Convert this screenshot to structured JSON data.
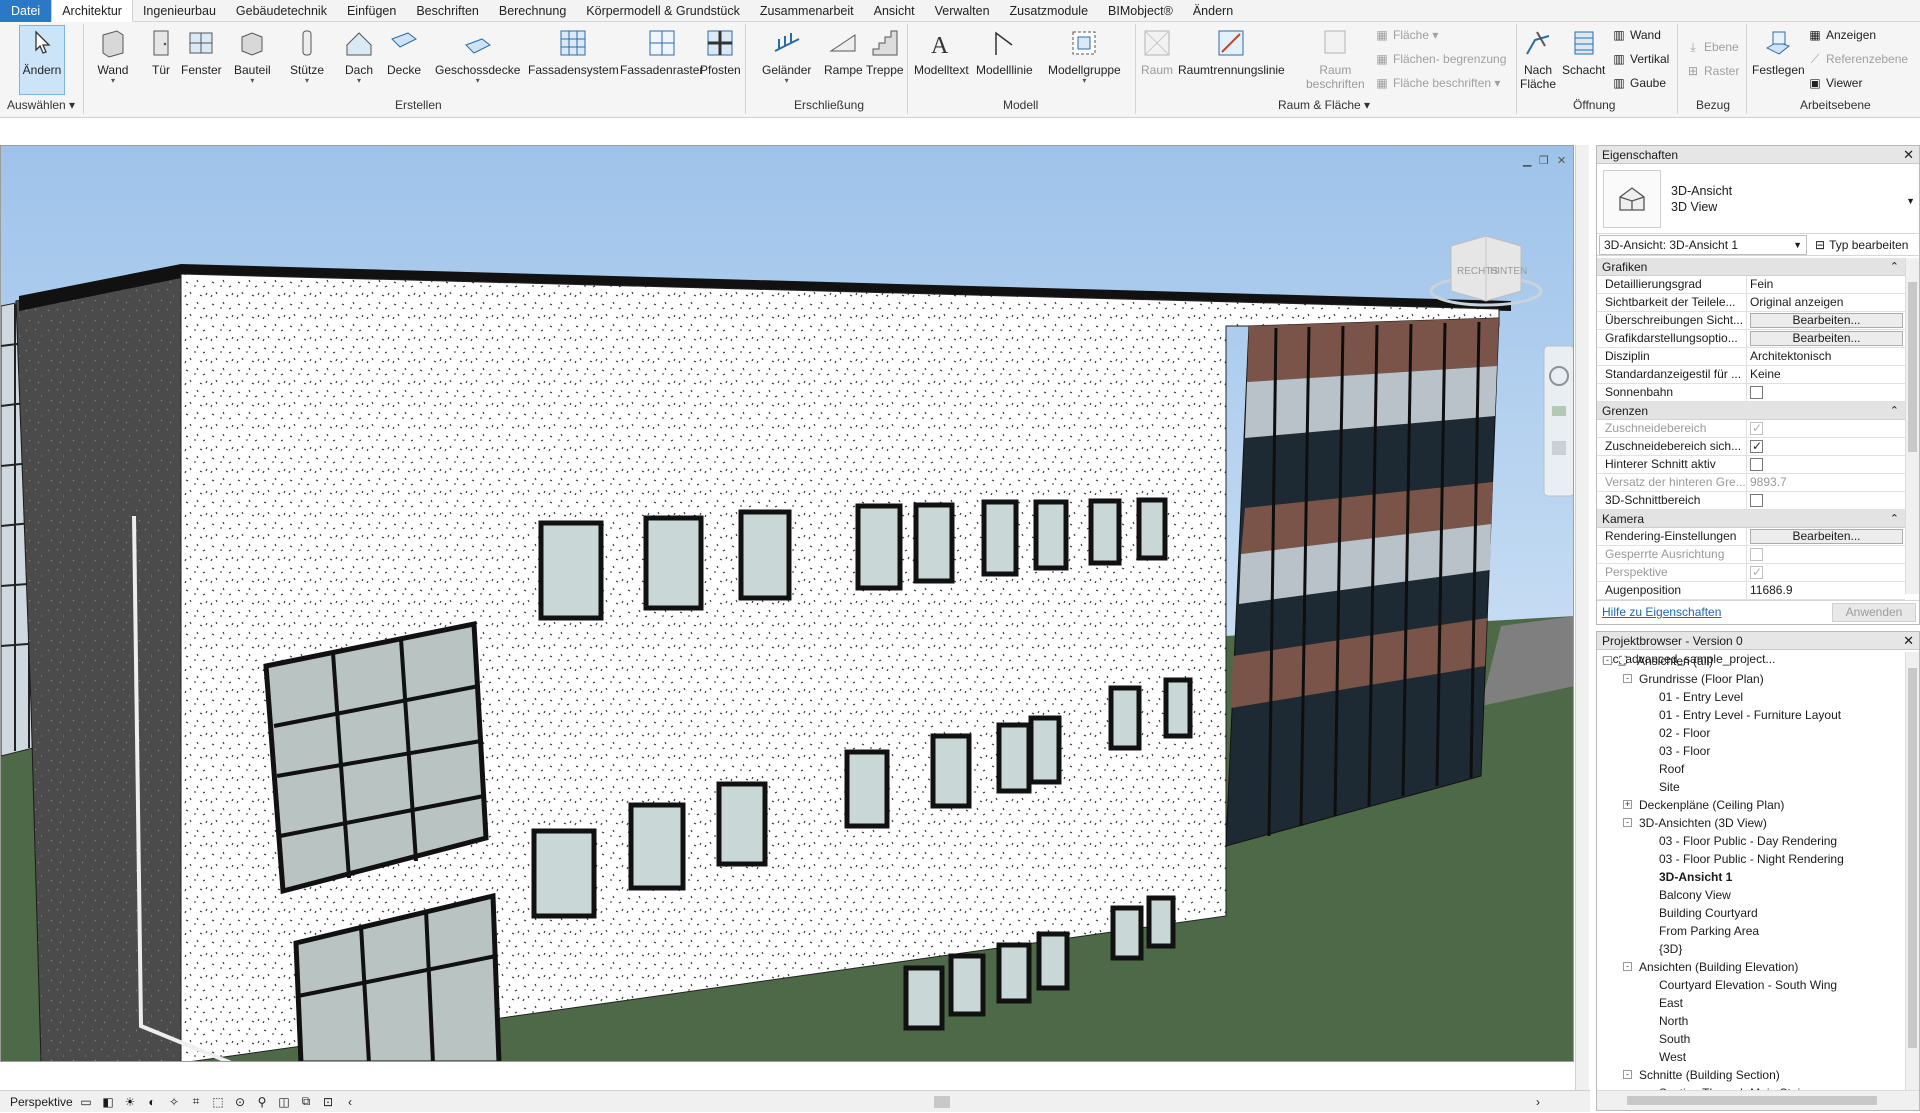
{
  "menu": {
    "tabs": [
      "Datei",
      "Architektur",
      "Ingenieurbau",
      "Gebäudetechnik",
      "Einfügen",
      "Beschriften",
      "Berechnung",
      "Körpermodell & Grundstück",
      "Zusammenarbeit",
      "Ansicht",
      "Verwalten",
      "Zusatzmodule",
      "BIMobject®",
      "Ändern"
    ],
    "active": "Architektur"
  },
  "ribbon": {
    "select": {
      "button": "Ändern",
      "group": "Auswählen"
    },
    "erstellen": {
      "buttons": [
        "Wand",
        "Tür",
        "Fenster",
        "Bauteil",
        "Stütze",
        "Dach",
        "Decke",
        "Geschossdecke",
        "Fassadensystem",
        "Fassadenraster",
        "Pfosten"
      ],
      "group": "Erstellen"
    },
    "erschliessung": {
      "buttons": [
        "Geländer",
        "Rampe",
        "Treppe"
      ],
      "group": "Erschließung"
    },
    "modell": {
      "buttons": [
        "Modelltext",
        "Modelllinie",
        "Modellgruppe"
      ],
      "group": "Modell"
    },
    "raum": {
      "buttons": [
        "Raum",
        "Raumtrennungslinie"
      ],
      "raum_beschriften": [
        "Raum",
        "beschriften"
      ],
      "small": [
        "Fläche",
        "Flächen- begrenzung",
        "Fläche beschriften"
      ],
      "group": "Raum & Fläche"
    },
    "oeffnung": {
      "buttons": [
        [
          "Nach",
          "Fläche"
        ],
        "Schacht"
      ],
      "small": [
        "Wand",
        "Vertikal",
        "Gaube"
      ],
      "group": "Öffnung"
    },
    "bezug": {
      "small": [
        "Ebene",
        "Raster"
      ],
      "group": "Bezug"
    },
    "arbeitsebene": {
      "button": "Festlegen",
      "small": [
        "Anzeigen",
        "Referenzebene",
        "Viewer"
      ],
      "group": "Arbeitsebene"
    }
  },
  "viewport": {
    "viewcube": {
      "right": "RECHTS",
      "back": "HINTEN"
    },
    "view_bar_label": "Perspektive"
  },
  "properties": {
    "title": "Eigenschaften",
    "type_name": "3D-Ansicht",
    "type_sub": "3D View",
    "instance": "3D-Ansicht: 3D-Ansicht 1",
    "type_edit": "Typ bearbeiten",
    "sections": [
      {
        "name": "Grafiken",
        "rows": [
          {
            "k": "Detaillierungsgrad",
            "v": "Fein"
          },
          {
            "k": "Sichtbarkeit der Teilele...",
            "v": "Original anzeigen"
          },
          {
            "k": "Überschreibungen Sicht...",
            "btn": "Bearbeiten..."
          },
          {
            "k": "Grafikdarstellungsoptio...",
            "btn": "Bearbeiten..."
          },
          {
            "k": "Disziplin",
            "v": "Architektonisch"
          },
          {
            "k": "Standardanzeigestil für ...",
            "v": "Keine"
          },
          {
            "k": "Sonnenbahn",
            "check": false
          }
        ]
      },
      {
        "name": "Grenzen",
        "rows": [
          {
            "k": "Zuschneidebereich",
            "check": true,
            "dim": true
          },
          {
            "k": "Zuschneidebereich sich...",
            "check": true
          },
          {
            "k": "Hinterer Schnitt aktiv",
            "check": false
          },
          {
            "k": "Versatz der hinteren Gre...",
            "v": "9893.7",
            "dim": true
          },
          {
            "k": "3D-Schnittbereich",
            "check": false
          }
        ]
      },
      {
        "name": "Kamera",
        "rows": [
          {
            "k": "Rendering-Einstellungen",
            "btn": "Bearbeiten..."
          },
          {
            "k": "Gesperrte Ausrichtung",
            "check": false,
            "dim": true
          },
          {
            "k": "Perspektive",
            "check": true,
            "dim": true
          },
          {
            "k": "Augenposition",
            "v": "11686.9"
          }
        ]
      }
    ],
    "help_link": "Hilfe zu Eigenschaften",
    "apply": "Anwenden"
  },
  "browser": {
    "title": "Projektbrowser - Version 0 rac_advanced_sample_project...",
    "nodes": [
      {
        "label": "Ansichten (all)",
        "level": 0,
        "toggle": "-"
      },
      {
        "label": "Grundrisse (Floor Plan)",
        "level": 1,
        "toggle": "-"
      },
      {
        "label": "01 - Entry Level",
        "level": 2
      },
      {
        "label": "01 - Entry Level - Furniture Layout",
        "level": 2
      },
      {
        "label": "02 - Floor",
        "level": 2
      },
      {
        "label": "03 - Floor",
        "level": 2
      },
      {
        "label": "Roof",
        "level": 2
      },
      {
        "label": "Site",
        "level": 2
      },
      {
        "label": "Deckenpläne (Ceiling Plan)",
        "level": 1,
        "toggle": "+"
      },
      {
        "label": "3D-Ansichten (3D View)",
        "level": 1,
        "toggle": "-"
      },
      {
        "label": "03 - Floor Public - Day Rendering",
        "level": 2
      },
      {
        "label": "03 - Floor Public - Night Rendering",
        "level": 2
      },
      {
        "label": "3D-Ansicht 1",
        "level": 2,
        "bold": true
      },
      {
        "label": "Balcony View",
        "level": 2
      },
      {
        "label": "Building Courtyard",
        "level": 2
      },
      {
        "label": "From Parking Area",
        "level": 2
      },
      {
        "label": "{3D}",
        "level": 2
      },
      {
        "label": "Ansichten (Building Elevation)",
        "level": 1,
        "toggle": "-"
      },
      {
        "label": "Courtyard Elevation - South Wing",
        "level": 2
      },
      {
        "label": "East",
        "level": 2
      },
      {
        "label": "North",
        "level": 2
      },
      {
        "label": "South",
        "level": 2
      },
      {
        "label": "West",
        "level": 2
      },
      {
        "label": "Schnitte (Building Section)",
        "level": 1,
        "toggle": "-"
      },
      {
        "label": "Section Through Main Stair",
        "level": 2
      }
    ]
  },
  "colors": {
    "accent": "#2b78c6",
    "selection": "#cce4f7",
    "sky_top": "#a8c9ec",
    "ground": "#4e6a48",
    "cladding": "#7a5448"
  }
}
